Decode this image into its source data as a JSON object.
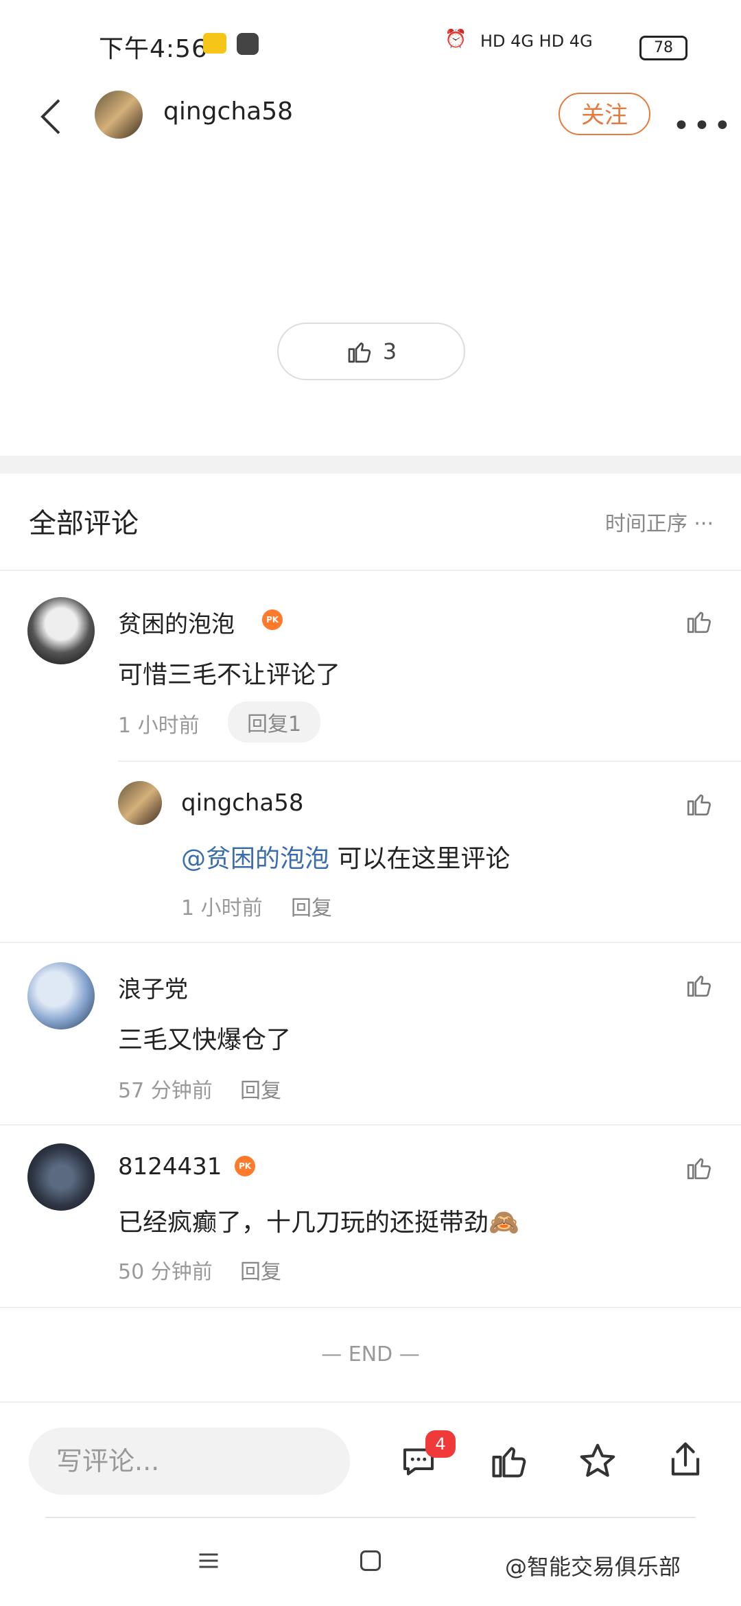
{
  "status": {
    "time": "下午4:56",
    "network": "HD 4G HD 4G",
    "battery": "78"
  },
  "header": {
    "username": "qingcha58",
    "follow_label": "关注",
    "more_label": "•••"
  },
  "post": {
    "like_count": "3"
  },
  "comments_section": {
    "title": "全部评论",
    "sort_label": "时间正序 ···"
  },
  "comments": [
    {
      "name": "贫困的泡泡",
      "pk": "PK",
      "text": "可惜三毛不让评论了",
      "time": "1 小时前",
      "reply_label": "回复1"
    },
    {
      "name": "浪子党",
      "text": "三毛又快爆仓了",
      "time": "57 分钟前",
      "reply_label": "回复"
    },
    {
      "name": "8124431",
      "pk": "PK",
      "text": "已经疯癫了，十几刀玩的还挺带劲🙈",
      "time": "50 分钟前",
      "reply_label": "回复"
    }
  ],
  "reply": {
    "name": "qingcha58",
    "mention": "@贫困的泡泡",
    "text": " 可以在这里评论",
    "time": "1 小时前",
    "reply_label": "回复"
  },
  "end_label": "— END —",
  "bottom": {
    "write_placeholder": "写评论...",
    "comment_badge": "4"
  },
  "watermark": "@智能交易俱乐部",
  "colors": {
    "accent": "#e67a3c",
    "mention": "#3b6cb0",
    "badge": "#f03a3a"
  }
}
